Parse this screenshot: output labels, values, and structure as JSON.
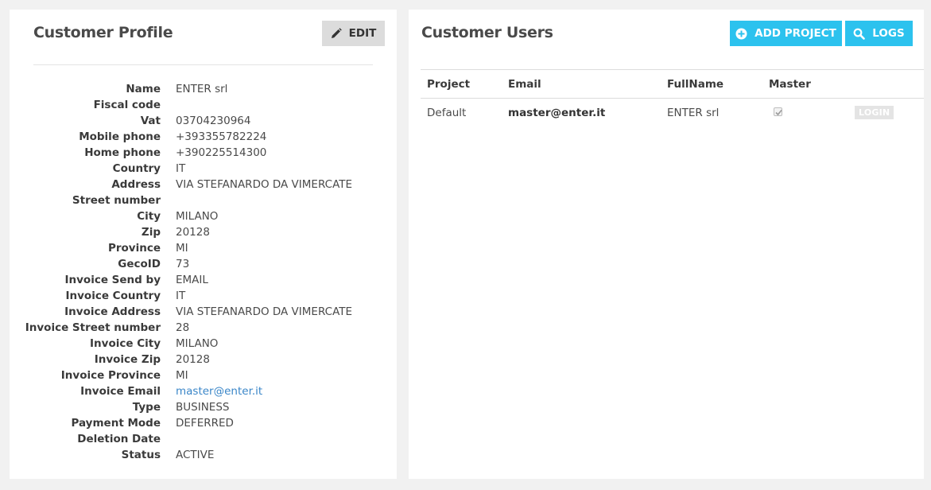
{
  "profile": {
    "title": "Customer Profile",
    "edit_label": "EDIT",
    "fields": [
      {
        "key": "Name",
        "value": "ENTER srl"
      },
      {
        "key": "Fiscal code",
        "value": ""
      },
      {
        "key": "Vat",
        "value": "03704230964"
      },
      {
        "key": "Mobile phone",
        "value": "+393355782224"
      },
      {
        "key": "Home phone",
        "value": "+390225514300"
      },
      {
        "key": "Country",
        "value": "IT"
      },
      {
        "key": "Address",
        "value": "VIA STEFANARDO DA VIMERCATE"
      },
      {
        "key": "Street number",
        "value": ""
      },
      {
        "key": "City",
        "value": "MILANO"
      },
      {
        "key": "Zip",
        "value": "20128"
      },
      {
        "key": "Province",
        "value": "MI"
      },
      {
        "key": "GecoID",
        "value": "73"
      },
      {
        "key": "Invoice Send by",
        "value": "EMAIL"
      },
      {
        "key": "Invoice Country",
        "value": "IT"
      },
      {
        "key": "Invoice Address",
        "value": "VIA STEFANARDO DA VIMERCATE"
      },
      {
        "key": "Invoice Street number",
        "value": "28"
      },
      {
        "key": "Invoice City",
        "value": "MILANO"
      },
      {
        "key": "Invoice Zip",
        "value": "20128"
      },
      {
        "key": "Invoice Province",
        "value": "MI"
      },
      {
        "key": "Invoice Email",
        "value": "master@enter.it"
      },
      {
        "key": "Type",
        "value": "BUSINESS"
      },
      {
        "key": "Payment Mode",
        "value": "DEFERRED"
      },
      {
        "key": "Deletion Date",
        "value": ""
      },
      {
        "key": "Status",
        "value": "ACTIVE"
      }
    ]
  },
  "users": {
    "title": "Customer Users",
    "add_project_label": "ADD PROJECT",
    "logs_label": "LOGS",
    "columns": [
      "Project",
      "Email",
      "FullName",
      "Master",
      ""
    ],
    "rows": [
      {
        "project": "Default",
        "email": "master@enter.it",
        "fullname": "ENTER srl",
        "master": true,
        "action": "LOGIN"
      }
    ]
  },
  "colors": {
    "accent": "#2cc2ee",
    "link": "#3a86c8",
    "background": "#f1f1f1"
  },
  "icons": {
    "edit": "pencil-icon",
    "add_project": "plus-circle-icon",
    "logs": "search-icon",
    "master": "checkbox-checked-icon"
  }
}
